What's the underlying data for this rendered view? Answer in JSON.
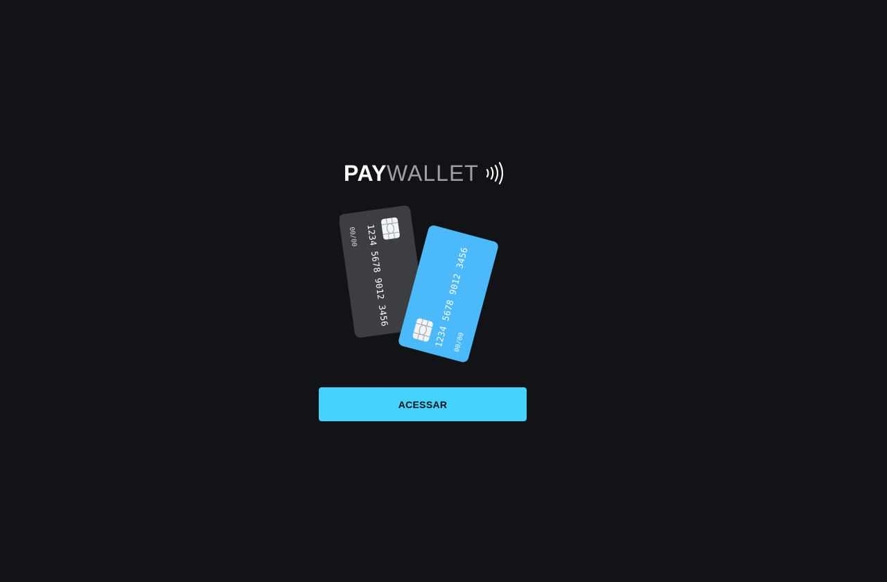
{
  "logo": {
    "part1": "PAY",
    "part2": "WALLET",
    "icon": "contactless-waves-icon"
  },
  "illustration": {
    "dark_card": {
      "number": "1234 5678 9012 3456",
      "expiry": "00/00",
      "color": "#3d3e42"
    },
    "blue_card": {
      "number": "1234 5678 9012 3456",
      "expiry": "00/00",
      "color": "#4bb9fa"
    }
  },
  "actions": {
    "access_label": "ACESSAR"
  },
  "theme": {
    "background": "#121316",
    "accent": "#45d2fd"
  }
}
